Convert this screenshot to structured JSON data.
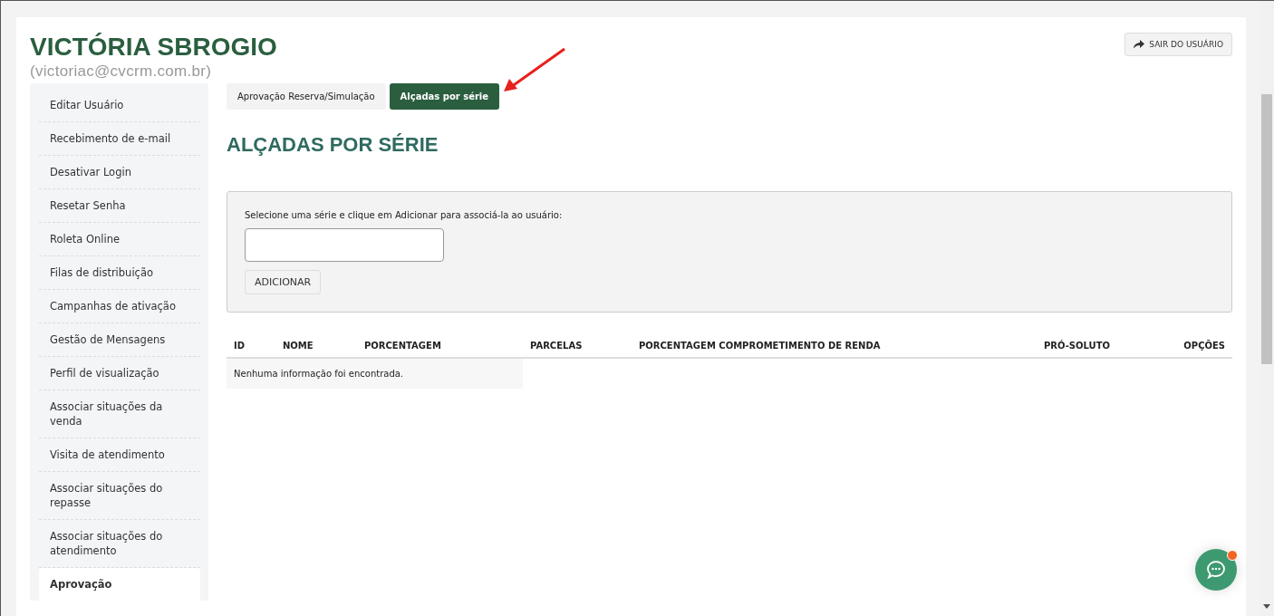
{
  "user": {
    "name": "VICTÓRIA SBROGIO",
    "email": "(victoriac@cvcrm.com.br)"
  },
  "logout_button": {
    "label": "SAIR DO USUÁRIO"
  },
  "sidebar": {
    "items": [
      {
        "label": "Editar Usuário",
        "selected": false
      },
      {
        "label": "Recebimento de e-mail",
        "selected": false
      },
      {
        "label": "Desativar Login",
        "selected": false
      },
      {
        "label": "Resetar Senha",
        "selected": false
      },
      {
        "label": "Roleta Online",
        "selected": false
      },
      {
        "label": "Filas de distribuição",
        "selected": false
      },
      {
        "label": "Campanhas de ativação",
        "selected": false
      },
      {
        "label": "Gestão de Mensagens",
        "selected": false
      },
      {
        "label": "Perfil de visualização",
        "selected": false
      },
      {
        "label": "Associar situações da venda",
        "selected": false
      },
      {
        "label": "Visita de atendimento",
        "selected": false
      },
      {
        "label": "Associar situações do repasse",
        "selected": false
      },
      {
        "label": "Associar situações do atendimento",
        "selected": false
      },
      {
        "label": "Aprovação",
        "selected": true
      }
    ]
  },
  "tabs": [
    {
      "label": "Aprovação Reserva/Simulação",
      "selected": false
    },
    {
      "label": "Alçadas por série",
      "selected": true
    }
  ],
  "heading": "ALÇADAS POR SÉRIE",
  "form": {
    "instruction": "Selecione uma série e clique em Adicionar para associá-la ao usuário:",
    "add_button": "ADICIONAR"
  },
  "table": {
    "columns": [
      "ID",
      "NOME",
      "PORCENTAGEM",
      "PARCELAS",
      "PORCENTAGEM COMPROMETIMENTO DE RENDA",
      "PRÓ-SOLUTO",
      "OPÇÕES"
    ],
    "empty_message": "Nenhuma informação foi encontrada."
  },
  "chat": {
    "unread": true
  }
}
